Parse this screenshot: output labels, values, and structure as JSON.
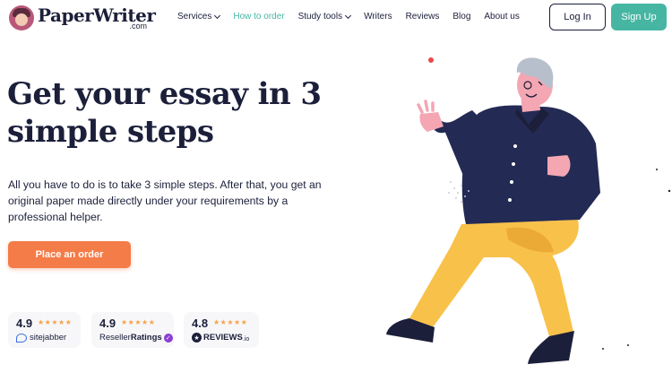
{
  "header": {
    "logo": {
      "name": "PaperWriter",
      "tld": ".com"
    },
    "nav": [
      {
        "label": "Services",
        "dropdown": true,
        "active": false
      },
      {
        "label": "How to order",
        "dropdown": false,
        "active": true
      },
      {
        "label": "Study tools",
        "dropdown": true,
        "active": false
      },
      {
        "label": "Writers",
        "dropdown": false,
        "active": false
      },
      {
        "label": "Reviews",
        "dropdown": false,
        "active": false
      },
      {
        "label": "Blog",
        "dropdown": false,
        "active": false
      },
      {
        "label": "About us",
        "dropdown": false,
        "active": false
      }
    ],
    "login_label": "Log In",
    "signup_label": "Sign Up"
  },
  "hero": {
    "title": "Get your essay in 3 simple steps",
    "description": "All you have to do is to take 3 simple steps. After that, you get an original paper made directly under your requirements by a professional helper.",
    "cta_label": "Place an order"
  },
  "ratings": [
    {
      "score": "4.9",
      "stars": "★★★★★",
      "brand": "sitejabber"
    },
    {
      "score": "4.9",
      "stars": "★★★★★",
      "brand_prefix": "Reseller",
      "brand_bold": "Ratings"
    },
    {
      "score": "4.8",
      "stars": "★★★★★",
      "brand_bold": "REVIEWS",
      "brand_suffix": ".io"
    }
  ],
  "colors": {
    "accent": "#46b6a3",
    "cta": "#f47c48",
    "text": "#1b1f3a",
    "stars": "#f5a34a"
  }
}
